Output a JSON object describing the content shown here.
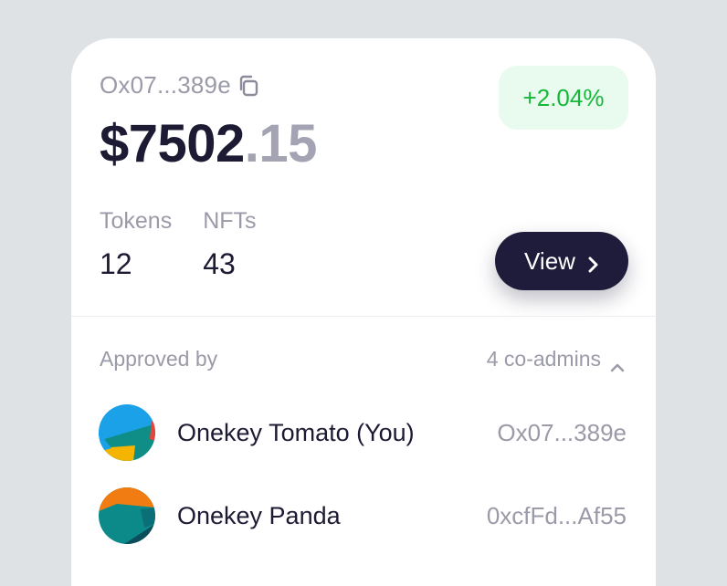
{
  "wallet": {
    "address": "Ox07...389e",
    "balance_int": "$7502",
    "balance_dec": ".15",
    "change": "+2.04%"
  },
  "stats": [
    {
      "label": "Tokens",
      "value": "12"
    },
    {
      "label": "NFTs",
      "value": "43"
    }
  ],
  "view_button": {
    "label": "View"
  },
  "approval": {
    "label": "Approved by",
    "coadmins": "4 co-admins"
  },
  "members": [
    {
      "name": "Onekey Tomato (You)",
      "address": "Ox07...389e"
    },
    {
      "name": "Onekey Panda",
      "address": "0xcfFd...Af55"
    }
  ],
  "colors": {
    "positive": "#16b83a",
    "positive_bg": "#e9fbef",
    "button_bg": "#1e1c3a",
    "text_primary": "#1c1b33",
    "text_muted": "#9a9aa8"
  },
  "icons": {
    "copy": "copy-icon",
    "view_chevron": "chevron-right-icon",
    "collapse": "chevron-up-icon"
  }
}
